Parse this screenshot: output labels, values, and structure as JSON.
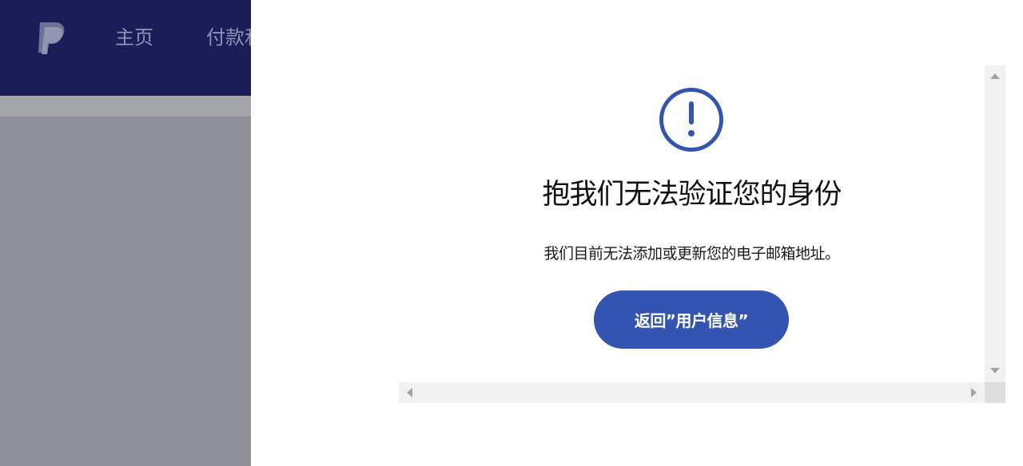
{
  "background_page": {
    "nav": {
      "home_label": "主页",
      "payments_label": "付款和"
    }
  },
  "dialog": {
    "icon": "exclamation-circle-icon",
    "title": "抱我们无法验证您的身份",
    "message": "我们目前无法添加或更新您的电子邮箱地址。",
    "back_button_label": "返回”用户信息”"
  },
  "colors": {
    "header_bg": "#1a1d57",
    "overlay_bg": "#8e9095",
    "accent": "#3354b0",
    "nav_text": "#8f92b4",
    "scrollbar_track": "#f1f1f1"
  }
}
